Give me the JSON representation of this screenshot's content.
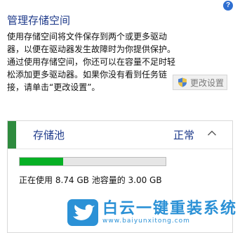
{
  "help_icon_glyph": "?",
  "title": "管理存储空间",
  "description": "使用存储空间将文件保存到两个或更多驱动器，以便在驱动器发生故障时为你提供保护。通过使用存储空间，你还可以在容量不足时轻松添加更多驱动器。如果你没有看到任务链接，请单击“更改设置”。",
  "change_settings_label": "更改设置",
  "pool": {
    "name": "存储池",
    "status": "正常",
    "usage_fraction": 0.3,
    "usage_text": "正在使用 8.74 GB 池容量的 3.00 GB"
  },
  "watermark": {
    "title": "白云一键重装系统",
    "url": "www.baiyunxitong.com"
  },
  "colors": {
    "accent": "#1e3a8a",
    "status_bar": "#2e8b3e",
    "usage_fill": "#06b025",
    "watermark": "#2b91d6"
  }
}
